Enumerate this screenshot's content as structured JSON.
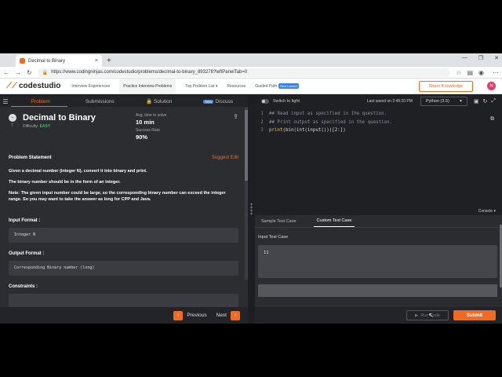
{
  "browser": {
    "tab_title": "Decimal to Binary",
    "tab_close": "×",
    "new_tab": "+",
    "url": "https://www.codingninjas.com/codestudio/problems/decimal-to-binary_893278?leftPanelTab=0"
  },
  "site": {
    "logo": "codestudio",
    "nav": [
      "Interview Experiences",
      "Practice Interview Problems",
      "Top Problem List",
      "Resources",
      "Guided Path"
    ],
    "new_launch": "New Launch",
    "share": "Share Knowledge",
    "avatar": "N"
  },
  "left": {
    "tabs": [
      "Problem",
      "Submissions",
      "Solution",
      "Discuss"
    ],
    "tab_new": "New",
    "difficulty_icon": "–",
    "number": "7",
    "title": "Decimal to Binary",
    "difficulty_label": "Difficulty:",
    "difficulty": "EASY",
    "avg_time_label": "Avg. time to solve",
    "avg_time": "10 min",
    "success_label": "Success Rate",
    "success": "90%",
    "statement_label": "Problem Statement",
    "suggest_edit": "Suggest Edit",
    "p1": "Given a decimal number (integer N), convert it into binary and print.",
    "p2": "The binary number should be in the form of an integer.",
    "p3_bold": "Note:",
    "p3": " The given input number could be large, so the corresponding binary number can exceed the integer range. So you may want to take the answer as long for CPP and Java.",
    "input_format_label": "Input Format :",
    "input_format": "Integer N",
    "output_format_label": "Output Format :",
    "output_format": "Corresponding Binary number (long)",
    "constraints_label": "Constraints :",
    "prev": "Previous",
    "next": "Next"
  },
  "editor": {
    "switch_light": "Switch to light",
    "last_saved": "Last saved on 2:49:20 PM",
    "language": "Python (3.5)",
    "lines": [
      {
        "n": "1",
        "text": "## Read input as specified in the question."
      },
      {
        "n": "2",
        "text": "## Print output as specified in the question."
      },
      {
        "n": "3",
        "fn": "print",
        "rest": "(bin(int(input()))[2:])"
      }
    ],
    "console": "Console",
    "sample_tab": "Sample Test Case",
    "custom_tab": "Custom Test Case",
    "input_label": "Input Test Case",
    "input_value": "11",
    "run": "Run Code",
    "submit": "Submit"
  },
  "colors": {
    "accent": "#f26a21",
    "easy": "#37c25c",
    "new_badge": "#3b82f6"
  }
}
